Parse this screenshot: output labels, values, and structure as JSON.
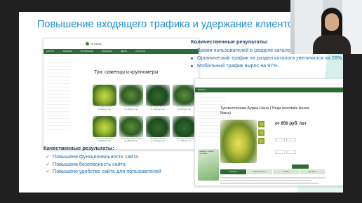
{
  "slide": {
    "title": "Повышение входящего трафика и удержание клиентов на"
  },
  "catalog_shot": {
    "nav_items": [
      "КАТАЛОГ",
      "ХВОЙНЫЕ",
      "ЛИСТВЕННЫЕ",
      "ПЛОДОВЫЕ",
      "ЦВЕТЫ",
      "КОНТАКТЫ"
    ],
    "heading": "Туи, саженцы и крупномеры",
    "products": [
      {
        "caption": "Туя западная Даника",
        "price": "от 990 руб. /шт"
      },
      {
        "caption": "Туя западная Смарагд",
        "price": "от 1 350 руб. /шт"
      },
      {
        "caption": "Туя западная Брабант",
        "price": "от 1 200 руб. /шт"
      },
      {
        "caption": "Туя западная Глобоза",
        "price": "от 870 руб. /шт"
      },
      {
        "caption": "Туя восточная Ауреа Нана",
        "price": "от 850 руб. /шт"
      },
      {
        "caption": "Туя западная Голден Смарагд",
        "price": "от 1 450 руб. /шт"
      },
      {
        "caption": "Туя западная Колумна",
        "price": "от 1 100 руб. /шт"
      },
      {
        "caption": "Туя западная Фастигиата",
        "price": "от 1 250 руб. /шт"
      }
    ]
  },
  "qualitative": {
    "heading": "Качественные результаты:",
    "items": [
      "Повышена функциональность сайта",
      "Повышена безопасность сайта",
      "Повышено удобство сайта для пользователей"
    ]
  },
  "quantitative": {
    "heading": "Количественные результаты:",
    "items": [
      "Время пользователей в разделе каталог у",
      "Органический трафик  на раздел каталога увеличился на 26%.",
      "Мобильный трафик вырос на 97%."
    ]
  },
  "product_shot": {
    "nav_label": "КАТАЛОГ",
    "title": "Туя восточная Ауреа Нана (Thuja orientalis Aurea Nana)",
    "price": "от 850 руб. /шт",
    "tabs": [
      "Описание",
      "Характеристики",
      "Отзывы",
      "Доставка"
    ],
    "promo": "Закажите онлайн с доставкой"
  },
  "colors": {
    "accent_blue": "#1a8fcf",
    "list_blue": "#1f6fb0",
    "brand_green": "#2e6b34"
  }
}
